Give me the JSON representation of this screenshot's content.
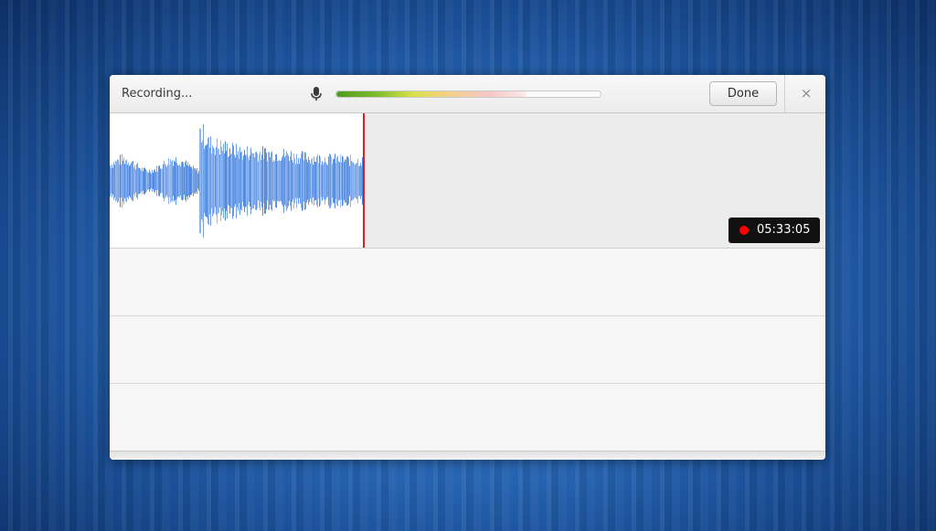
{
  "header": {
    "status_text": "Recording...",
    "mic_icon": "microphone-icon",
    "input_level": 0.72,
    "done_label": "Done",
    "close_label": "×",
    "close_icon": "close-icon"
  },
  "recorder": {
    "timer": "05:33:05",
    "indicator_icon": "record-dot-icon",
    "indicator_color": "#ff0000",
    "waveform_color": "#4a86e0",
    "playhead_color": "#d0232b"
  },
  "recordings": {
    "rows": [
      {},
      {},
      {}
    ]
  }
}
